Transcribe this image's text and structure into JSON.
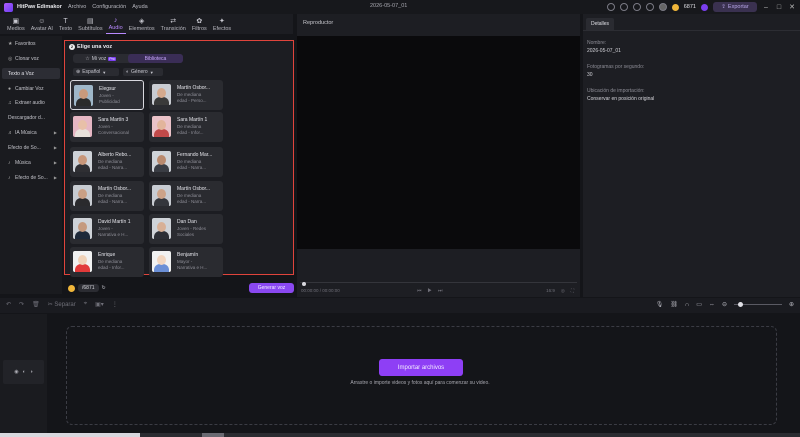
{
  "titlebar": {
    "app_name": "HitPaw Edimakor",
    "menu": [
      "Archivo",
      "Configuración",
      "Ayuda"
    ],
    "doc_title": "2026-05-07_01",
    "credits": "6871",
    "export_label": "Exportar"
  },
  "tabs": [
    {
      "label": "Medios",
      "icon": "media-icon"
    },
    {
      "label": "Avatar AI",
      "icon": "avatar-icon"
    },
    {
      "label": "Texto",
      "icon": "text-icon"
    },
    {
      "label": "Subtítulos",
      "icon": "subtitles-icon"
    },
    {
      "label": "Audio",
      "icon": "audio-icon",
      "active": true
    },
    {
      "label": "Elementos",
      "icon": "elements-icon"
    },
    {
      "label": "Transición",
      "icon": "transition-icon"
    },
    {
      "label": "Filtros",
      "icon": "filters-icon"
    },
    {
      "label": "Efectos",
      "icon": "effects-icon"
    }
  ],
  "sidebar": {
    "items": [
      {
        "label": "Favoritos",
        "icon": "star-icon"
      },
      {
        "label": "Clonar voz",
        "icon": "clone-icon"
      },
      {
        "label": "Texto a Voz",
        "icon": "tts-icon",
        "active": true
      },
      {
        "label": "Cambiar Voz",
        "icon": "mic-icon"
      },
      {
        "label": "Extraer audio",
        "icon": "extract-icon"
      },
      {
        "label": "Descargador d...",
        "icon": "download-icon"
      },
      {
        "label": "IA Música",
        "icon": "ai-music-icon",
        "caret": true
      },
      {
        "label": "Efecto de So...",
        "icon": "sound-effect-icon",
        "caret": true
      },
      {
        "label": "Música",
        "icon": "music-icon",
        "caret": true
      },
      {
        "label": "Efecto de So...",
        "icon": "sound-effect-icon",
        "caret": true
      }
    ]
  },
  "voice_panel": {
    "title_num": "2",
    "title": "Elige una voz",
    "seg_my_voice": "Mi voz",
    "seg_pro": "Pro",
    "seg_library": "Biblioteca",
    "filter_language": "Español",
    "filter_gender": "Género",
    "voices": [
      {
        "name": "Elegsur",
        "desc1": "Joven -",
        "desc2": "Publicidad",
        "selected": true,
        "skin": "#c99a7c",
        "shirt": "#2b2b2b",
        "bg": "#9fb7c9"
      },
      {
        "name": "Martín Osbor...",
        "desc1": "De mediana",
        "desc2": "edad - Perso...",
        "skin": "#d4a98d",
        "shirt": "#3a3a3a",
        "bg": "#c9ccd2"
      },
      {
        "name": "Sara Martín 3",
        "desc1": "Joven -",
        "desc2": "Conversacional",
        "skin": "#e8c0a8",
        "shirt": "#e9e2dc",
        "bg": "#e6b7c4"
      },
      {
        "name": "Sara Martín 1",
        "desc1": "De mediana",
        "desc2": "edad - Infor...",
        "skin": "#e2b59c",
        "shirt": "#c24a4a",
        "bg": "#eac2c8"
      },
      {
        "name": "Alberto Rebo...",
        "desc1": "De mediana",
        "desc2": "edad - Narra...",
        "skin": "#c8977a",
        "shirt": "#2f2f33",
        "bg": "#cfd3d8"
      },
      {
        "name": "Fernando Mar...",
        "desc1": "De mediana",
        "desc2": "edad - Narra...",
        "skin": "#b98a6e",
        "shirt": "#3a3d44",
        "bg": "#cfd3d8"
      },
      {
        "name": "Martín Osbor...",
        "desc1": "De mediana",
        "desc2": "edad - Narra...",
        "skin": "#caa085",
        "shirt": "#2a2a2d",
        "bg": "#c8ccd2"
      },
      {
        "name": "Martín Osbor...",
        "desc1": "De mediana",
        "desc2": "edad - Narra...",
        "skin": "#cda388",
        "shirt": "#34363c",
        "bg": "#c8ccd2"
      },
      {
        "name": "David Martín 1",
        "desc1": "Joven -",
        "desc2": "Narrativa e H...",
        "skin": "#c59a7e",
        "shirt": "#1f2a3a",
        "bg": "#cfd3d8"
      },
      {
        "name": "Dan Dan",
        "desc1": "Joven - Redes",
        "desc2": "Sociales",
        "skin": "#d8b096",
        "shirt": "#2d2f36",
        "bg": "#cfd3d8"
      },
      {
        "name": "Enrique",
        "desc1": "De mediana",
        "desc2": "edad - Infor...",
        "skin": "#f0d2b8",
        "shirt": "#e23a3a",
        "bg": "#f2f2f2"
      },
      {
        "name": "Benjamín",
        "desc1": "Mayor -",
        "desc2": "Narrativa e H...",
        "skin": "#f2d6c0",
        "shirt": "#6b8fd6",
        "bg": "#f2f2f2"
      }
    ],
    "credit_label": "/6871",
    "generate_label": "Generar voz"
  },
  "player": {
    "label": "Reproductor",
    "time": "00:00:00 / 00:00:00",
    "ratio": "16:9"
  },
  "details": {
    "tab": "Detalles",
    "fields": [
      {
        "label": "Nombre:",
        "value": "2026-05-07_01"
      },
      {
        "label": "Fotogramas por segundo:",
        "value": "30"
      },
      {
        "label": "Ubicación de importación:",
        "value": "Conservar en posición original"
      }
    ]
  },
  "timeline": {
    "separate_label": "Separar",
    "import_label": "Importar archivos",
    "hint": "Arrastre o importe videos y fotos aquí para comenzar su video."
  }
}
